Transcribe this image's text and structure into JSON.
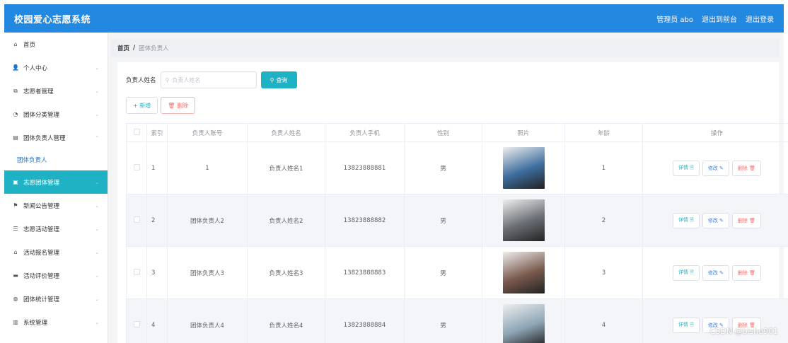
{
  "header": {
    "title": "校园爱心志愿系统",
    "user": "管理员 abo",
    "to_front": "退出到前台",
    "logout": "退出登录"
  },
  "sidebar": {
    "items": [
      {
        "label": "首页",
        "icon": "home-icon",
        "glyph": "⌂",
        "chev": ""
      },
      {
        "label": "个人中心",
        "icon": "user-icon",
        "glyph": "👤",
        "chev": "⌄"
      },
      {
        "label": "志愿者管理",
        "icon": "copy-icon",
        "glyph": "⧉",
        "chev": "⌄"
      },
      {
        "label": "团体分类管理",
        "icon": "gauge-icon",
        "glyph": "◔",
        "chev": "⌄"
      },
      {
        "label": "团体负责人管理",
        "icon": "list-icon",
        "glyph": "▤",
        "chev": "⌃"
      },
      {
        "label": "团体负责人",
        "sub": true
      },
      {
        "label": "志愿团体管理",
        "icon": "group-icon",
        "glyph": "▣",
        "chev": "⌄",
        "active": true
      },
      {
        "label": "新闻公告管理",
        "icon": "flag-icon",
        "glyph": "⚑",
        "chev": "⌄"
      },
      {
        "label": "志愿活动管理",
        "icon": "sliders-icon",
        "glyph": "☰",
        "chev": "⌄"
      },
      {
        "label": "活动报名管理",
        "icon": "bank-icon",
        "glyph": "⌂",
        "chev": "⌄"
      },
      {
        "label": "活动评价管理",
        "icon": "card-icon",
        "glyph": "▬",
        "chev": "⌄"
      },
      {
        "label": "团体统计管理",
        "icon": "globe-icon",
        "glyph": "◍",
        "chev": "⌄"
      },
      {
        "label": "系统管理",
        "icon": "chart-icon",
        "glyph": "▥",
        "chev": "⌄"
      }
    ]
  },
  "breadcrumb": {
    "home": "首页",
    "sep": "/",
    "current": "团体负责人"
  },
  "search": {
    "label": "负责人姓名",
    "placeholder": "负责人姓名",
    "button": "查询"
  },
  "actions": {
    "add": "+ 新增",
    "delete": "🗑 删除"
  },
  "table": {
    "headers": [
      "",
      "索引",
      "负责人账号",
      "负责人姓名",
      "负责人手机",
      "性别",
      "照片",
      "年龄",
      "操作"
    ],
    "rows": [
      {
        "index": "1",
        "account": "1",
        "name": "负责人姓名1",
        "phone": "13823888881",
        "gender": "男",
        "age": "1",
        "photo": "#3d6e9e"
      },
      {
        "index": "2",
        "account": "团体负责人2",
        "name": "负责人姓名2",
        "phone": "13823888882",
        "gender": "男",
        "age": "2",
        "photo": "#6a6e74"
      },
      {
        "index": "3",
        "account": "团体负责人3",
        "name": "负责人姓名3",
        "phone": "13823888883",
        "gender": "男",
        "age": "3",
        "photo": "#7a5a4e"
      },
      {
        "index": "4",
        "account": "团体负责人4",
        "name": "负责人姓名4",
        "phone": "13823888884",
        "gender": "男",
        "age": "4",
        "photo": "#8ea6b6"
      }
    ],
    "ops": {
      "detail": "详情 🗎",
      "edit": "修改 ✎",
      "remove": "删除 🗑"
    }
  },
  "watermark": "CSDN @bishe901"
}
